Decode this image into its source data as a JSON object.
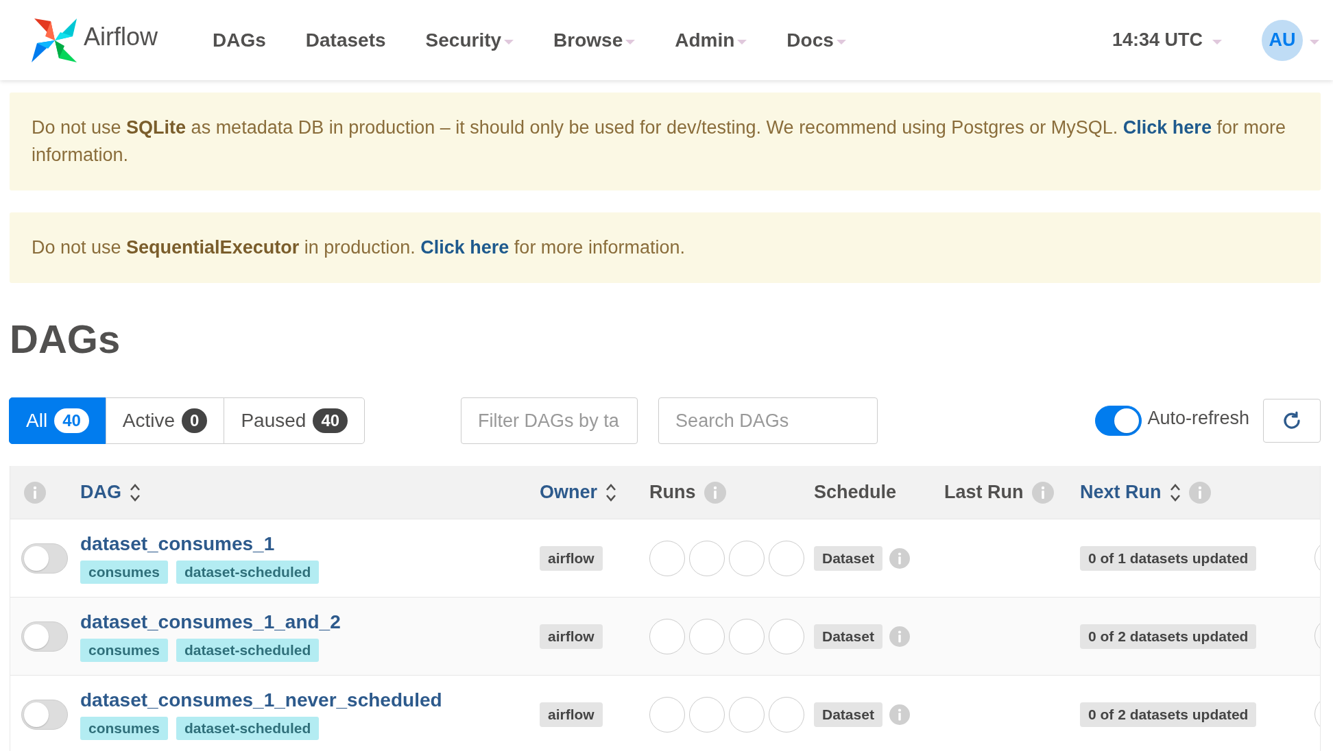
{
  "brand": "Airflow",
  "nav": [
    {
      "label": "DAGs",
      "dropdown": false
    },
    {
      "label": "Datasets",
      "dropdown": false
    },
    {
      "label": "Security",
      "dropdown": true
    },
    {
      "label": "Browse",
      "dropdown": true
    },
    {
      "label": "Admin",
      "dropdown": true
    },
    {
      "label": "Docs",
      "dropdown": true
    }
  ],
  "clock": "14:34 UTC",
  "user_initials": "AU",
  "alerts": [
    {
      "before": "Do not use **SQLite** as metadata DB in production – it should only be used for dev/testing. We recommend using Postgres or MySQL. ",
      "link": "Click here",
      "after": " for more information."
    },
    {
      "before": "Do not use **SequentialExecutor** in production. ",
      "link": "Click here",
      "after": " for more information."
    }
  ],
  "heading": "DAGs",
  "status_tabs": [
    {
      "label": "All",
      "count": "40",
      "selected": true
    },
    {
      "label": "Active",
      "count": "0",
      "selected": false
    },
    {
      "label": "Paused",
      "count": "40",
      "selected": false
    }
  ],
  "tag_filter": {
    "placeholder": "Filter DAGs by ta"
  },
  "search": {
    "placeholder": "Search DAGs"
  },
  "auto_refresh": {
    "label": "Auto-refresh",
    "on": true
  },
  "table": {
    "columns": [
      {
        "info": true
      },
      {
        "label": "DAG",
        "sortable": true,
        "info": false
      },
      {
        "label": "Owner",
        "sortable": true,
        "info": false
      },
      {
        "label": "Runs",
        "sortable": false,
        "info": true
      },
      {
        "label": "Schedule",
        "sortable": false,
        "info": false
      },
      {
        "label": "Last Run",
        "sortable": false,
        "info": true
      },
      {
        "label": "Next Run",
        "sortable": true,
        "info": true
      }
    ],
    "rows": [
      {
        "on": false,
        "name": "dataset_consumes_1",
        "tags": [
          "consumes",
          "dataset-scheduled"
        ],
        "owner": "airflow",
        "schedule": "Dataset",
        "next_run": "0 of 1 datasets updated"
      },
      {
        "on": false,
        "name": "dataset_consumes_1_and_2",
        "tags": [
          "consumes",
          "dataset-scheduled"
        ],
        "owner": "airflow",
        "schedule": "Dataset",
        "next_run": "0 of 2 datasets updated"
      },
      {
        "on": false,
        "name": "dataset_consumes_1_never_scheduled",
        "tags": [
          "consumes",
          "dataset-scheduled"
        ],
        "owner": "airflow",
        "schedule": "Dataset",
        "next_run": "0 of 2 datasets updated"
      }
    ]
  }
}
